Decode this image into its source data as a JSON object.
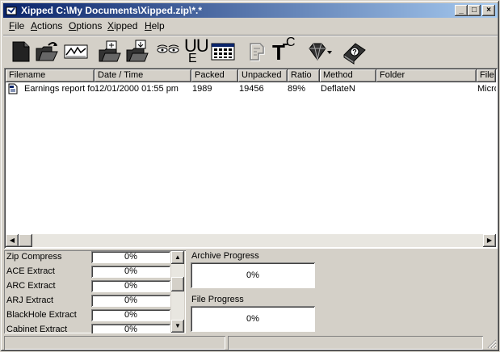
{
  "window": {
    "title": "Xipped C:\\My Documents\\Xipped.zip\\*.*",
    "buttons": {
      "minimize": "_",
      "maximize": "□",
      "close": "×"
    }
  },
  "menu": [
    {
      "pre": "",
      "u": "F",
      "post": "ile"
    },
    {
      "pre": "",
      "u": "A",
      "post": "ctions"
    },
    {
      "pre": "",
      "u": "O",
      "post": "ptions"
    },
    {
      "pre": "",
      "u": "X",
      "post": "ipped"
    },
    {
      "pre": "",
      "u": "H",
      "post": "elp"
    }
  ],
  "toolbar": {
    "icons": [
      "new-archive-icon",
      "open-archive-icon",
      "view-file-icon",
      "add-files-icon",
      "extract-files-icon",
      "view-icon",
      "uu-encode-icon",
      "select-all-icon",
      "disabled-tool-icon",
      "tools-icon",
      "gem-dropdown-icon",
      "help-book-icon"
    ],
    "uu_label": "UU",
    "uu_sub": "E",
    "tools_label": "T",
    "tools_sub": "C"
  },
  "file_list": {
    "columns": [
      "Filename",
      "Date / Time",
      "Packed",
      "Unpacked",
      "Ratio",
      "Method",
      "Folder",
      "File"
    ],
    "rows": [
      {
        "filename": "Earnings report fo",
        "datetime": "12/01/2000 01:55 pm",
        "packed": "1989",
        "unpacked": "19456",
        "ratio": "89%",
        "method": "DeflateN",
        "folder": "",
        "file": "Micro"
      }
    ]
  },
  "engines": [
    {
      "name": "Zip Compress",
      "value": "0%"
    },
    {
      "name": "ACE Extract",
      "value": "0%"
    },
    {
      "name": "ARC Extract",
      "value": "0%"
    },
    {
      "name": "ARJ Extract",
      "value": "0%"
    },
    {
      "name": "BlackHole Extract",
      "value": "0%"
    },
    {
      "name": "Cabinet Extract",
      "value": "0%"
    }
  ],
  "progress": {
    "archive_label": "Archive Progress",
    "archive_value": "0%",
    "file_label": "File Progress",
    "file_value": "0%"
  },
  "colors": {
    "face": "#d4d0c8",
    "title_start": "#0a246a",
    "title_end": "#a6caf0"
  }
}
